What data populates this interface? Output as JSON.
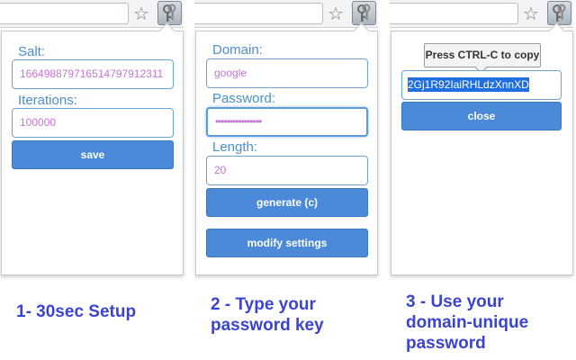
{
  "panels": [
    {
      "icons": {
        "star": "star-icon",
        "extension": "keys-icon"
      },
      "salt_label": "Salt:",
      "salt_value": "166498879716514797912311",
      "iterations_label": "Iterations:",
      "iterations_value": "100000",
      "save_label": "save",
      "caption": "1- 30sec Setup"
    },
    {
      "domain_label": "Domain:",
      "domain_value": "google",
      "password_label": "Password:",
      "password_value": "••••••••••••••••",
      "length_label": "Length:",
      "length_value": "20",
      "generate_label": "generate (c)",
      "modify_label": "modify settings",
      "caption_line1": "2 - Type your",
      "caption_line2": "password key"
    },
    {
      "tooltip": "Press CTRL-C to copy",
      "generated_password": "2Gj1R92IaiRHLdzXnnXD",
      "close_label": "close",
      "caption_line1": "3 - Use your",
      "caption_line2": "domain-unique",
      "caption_line3": "password"
    }
  ],
  "colors": {
    "accent": "#4a8ad8",
    "label": "#4a8fd0",
    "field_text": "#c674d6",
    "caption": "#3b44d2",
    "selection": "#1f6fe0"
  }
}
